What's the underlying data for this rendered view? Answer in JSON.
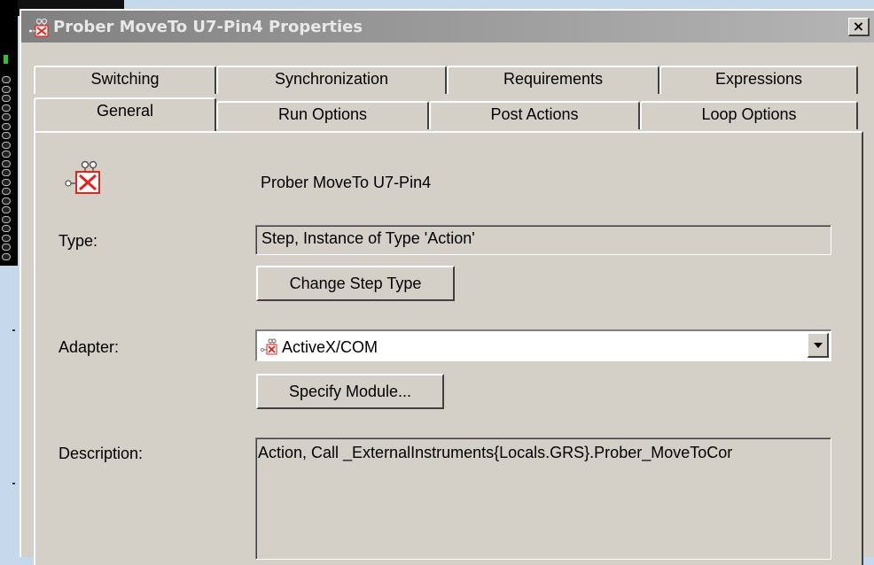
{
  "window": {
    "title": "Prober MoveTo U7-Pin4 Properties",
    "close_glyph": "×"
  },
  "tabs": {
    "row_back": [
      {
        "label": "Switching"
      },
      {
        "label": "Synchronization"
      },
      {
        "label": "Requirements"
      },
      {
        "label": "Expressions"
      }
    ],
    "row_front": [
      {
        "label": "General"
      },
      {
        "label": "Run Options"
      },
      {
        "label": "Post Actions"
      },
      {
        "label": "Loop Options"
      }
    ],
    "active": "General"
  },
  "general": {
    "step_name": "Prober MoveTo U7-Pin4",
    "type_label": "Type:",
    "type_value": "Step, Instance of Type 'Action'",
    "change_step_type_button": "Change Step Type",
    "adapter_label": "Adapter:",
    "adapter_value": "ActiveX/COM",
    "specify_module_button": "Specify Module...",
    "description_label": "Description:",
    "description_value": "Action,  Call _ExternalInstruments{Locals.GRS}.Prober_MoveToCor"
  },
  "icons": {
    "window_icon": "action-step-icon",
    "step_icon": "action-step-icon",
    "adapter_icon": "activex-adapter-icon",
    "dropdown": "chevron-down-icon"
  },
  "colors": {
    "titlebar_start": "#808080",
    "titlebar_end": "#b5b5b5",
    "dialog_face": "#d4d0c8",
    "desktop": "#c6d8ec",
    "icon_red": "#e8211a"
  }
}
